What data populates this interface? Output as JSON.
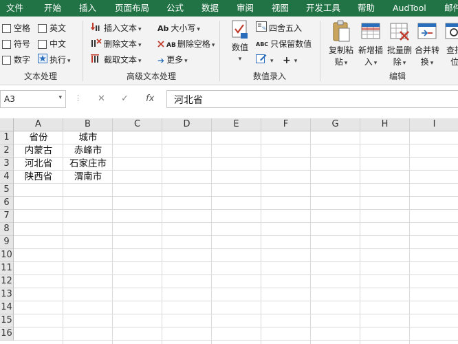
{
  "ribbon_tabs": [
    "文件",
    "开始",
    "插入",
    "页面布局",
    "公式",
    "数据",
    "审阅",
    "视图",
    "开发工具",
    "帮助",
    "AudTool",
    "邮件"
  ],
  "groups": {
    "text_processing": {
      "label": "文本处理",
      "checkboxes": [
        "空格",
        "英文",
        "符号",
        "中文",
        "数字"
      ],
      "execute_label": "执行"
    },
    "advanced_text": {
      "label": "高级文本处理",
      "items": [
        "插入文本",
        "删除文本",
        "截取文本",
        "大小写",
        "删除空格",
        "更多"
      ],
      "case_prefix": "Ab",
      "space_prefix": "AB"
    },
    "number_entry": {
      "label": "数值录入",
      "big_button": "数值",
      "items": [
        "四舍五入",
        "只保留数值"
      ],
      "keep_prefix": "ABC"
    },
    "edit": {
      "label": "编辑",
      "buttons": [
        {
          "line1": "复制粘",
          "line2": "贴"
        },
        {
          "line1": "新增插",
          "line2": "入"
        },
        {
          "line1": "批量删",
          "line2": "除"
        },
        {
          "line1": "合并转",
          "line2": "换"
        },
        {
          "line1": "查找",
          "line2": "位"
        }
      ]
    }
  },
  "formula_bar": {
    "name_box": "A3",
    "cancel_symbol": "✕",
    "enter_symbol": "✓",
    "fx_label": "fx",
    "content": "河北省"
  },
  "sheet": {
    "columns": [
      "A",
      "B",
      "C",
      "D",
      "E",
      "F",
      "G",
      "H",
      "I"
    ],
    "rows": [
      "1",
      "2",
      "3",
      "4",
      "5",
      "6",
      "7",
      "8",
      "9",
      "10",
      "11",
      "12",
      "13",
      "14",
      "15",
      "16"
    ],
    "cells": [
      [
        "省份",
        "城市"
      ],
      [
        "内蒙古",
        "赤峰市"
      ],
      [
        "河北省",
        "石家庄市"
      ],
      [
        "陕西省",
        "渭南市"
      ]
    ],
    "active_cell": "A3"
  },
  "colors": {
    "tab_bar": "#217346",
    "ribbon_bg": "#f3f3f3",
    "header_bg": "#e6e6e6",
    "gridline": "#dadada",
    "accent_red": "#c0392b",
    "accent_blue": "#2a6ebb"
  }
}
